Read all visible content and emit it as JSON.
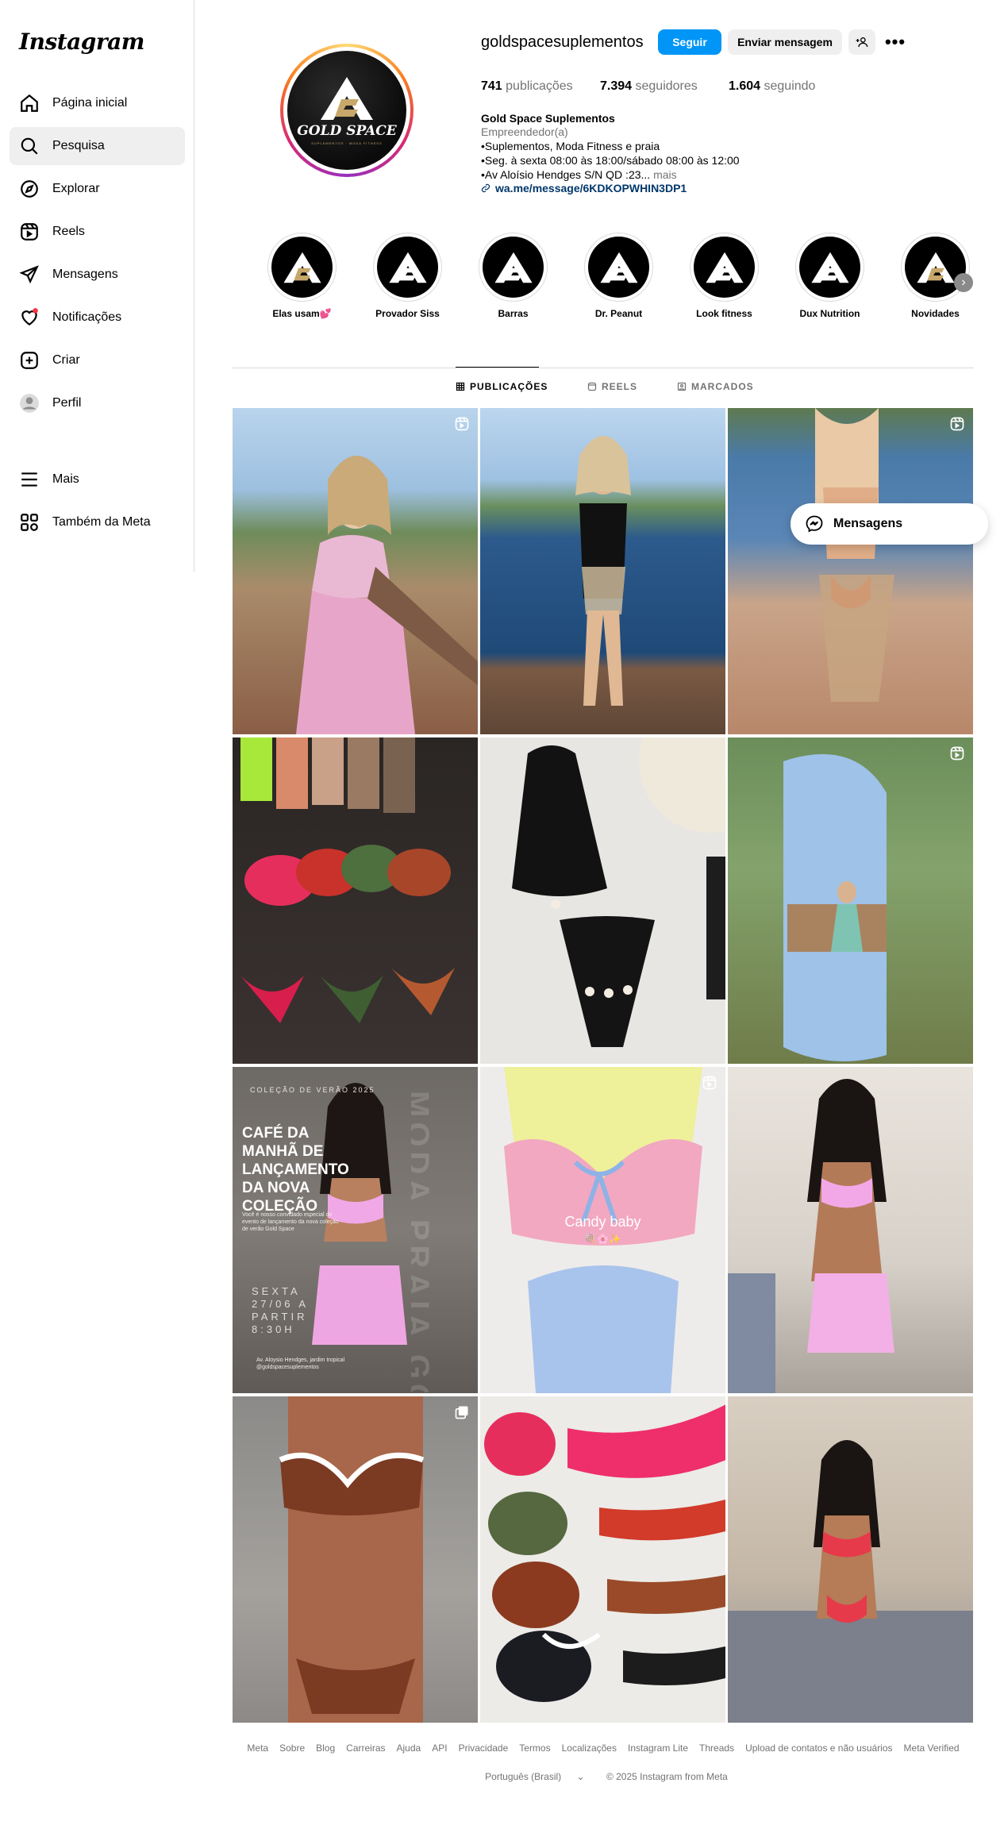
{
  "app": {
    "logo_text": "Instagram"
  },
  "sidebar": {
    "items": [
      {
        "label": "Página inicial",
        "icon": "home-icon"
      },
      {
        "label": "Pesquisa",
        "icon": "search-icon"
      },
      {
        "label": "Explorar",
        "icon": "compass-icon"
      },
      {
        "label": "Reels",
        "icon": "reels-icon"
      },
      {
        "label": "Mensagens",
        "icon": "send-icon"
      },
      {
        "label": "Notificações",
        "icon": "heart-icon"
      },
      {
        "label": "Criar",
        "icon": "plus-square-icon"
      },
      {
        "label": "Perfil",
        "icon": "profile-avatar-icon"
      },
      {
        "label": "Mais",
        "icon": "menu-icon"
      },
      {
        "label": "Também da Meta",
        "icon": "meta-apps-icon"
      }
    ],
    "active_index": 1
  },
  "profile": {
    "avatar": {
      "brand": "GOLD SPACE",
      "tagline": "SUPLEMENTOS · MODA FITNESS"
    },
    "username": "goldspacesuplementos",
    "follow_label": "Seguir",
    "message_label": "Enviar mensagem",
    "stats": {
      "posts_count": "741",
      "posts_label": "publicações",
      "followers_count": "7.394",
      "followers_label": "seguidores",
      "following_count": "1.604",
      "following_label": "seguindo"
    },
    "bio": {
      "name": "Gold Space Suplementos",
      "category": "Empreendedor(a)",
      "line1": "•Suplementos, Moda Fitness e praia",
      "line2": "•Seg. à sexta 08:00 às 18:00/sábado 08:00 às 12:00",
      "line3": "•Av Aloísio Hendges S/N QD :23...",
      "more": "mais",
      "link": "wa.me/message/6KDKOPWHIN3DP1"
    }
  },
  "highlights": [
    {
      "label": "Elas usam💕"
    },
    {
      "label": "Provador Siss"
    },
    {
      "label": "Barras"
    },
    {
      "label": "Dr. Peanut"
    },
    {
      "label": "Look fitness"
    },
    {
      "label": "Dux Nutrition"
    },
    {
      "label": "Novidades"
    }
  ],
  "tabs": [
    {
      "label": "PUBLICAÇÕES",
      "icon": "grid-icon",
      "active": true
    },
    {
      "label": "REELS",
      "icon": "reels-icon",
      "active": false
    },
    {
      "label": "MARCADOS",
      "icon": "tagged-icon",
      "active": false
    }
  ],
  "posts": {
    "post7": {
      "small_title": "COLEÇÃO DE VERÃO 2025",
      "headline": "CAFÉ DA MANHÃ DE LANÇAMENTO DA NOVA COLEÇÃO",
      "body": "Você é nosso convidado especial do evento de lançamento da nova coleção de verão Gold Space",
      "date": "SEXTA 27/06 A PARTIR 8:30H",
      "address": "Av. Aloysio Hendges, jardim tropical @goldspacesuplementos",
      "vertical": "MODA PRAIA GOLD SPACE"
    },
    "post8": {
      "caption": "Candy baby",
      "emoji": "🍭🌸✨"
    }
  },
  "floating_messages": {
    "label": "Mensagens"
  },
  "footer": {
    "links": [
      "Meta",
      "Sobre",
      "Blog",
      "Carreiras",
      "Ajuda",
      "API",
      "Privacidade",
      "Termos",
      "Localizações",
      "Instagram Lite",
      "Threads",
      "Upload de contatos e não usuários",
      "Meta Verified"
    ],
    "language": "Português (Brasil)",
    "copyright": "© 2025 Instagram from Meta"
  }
}
